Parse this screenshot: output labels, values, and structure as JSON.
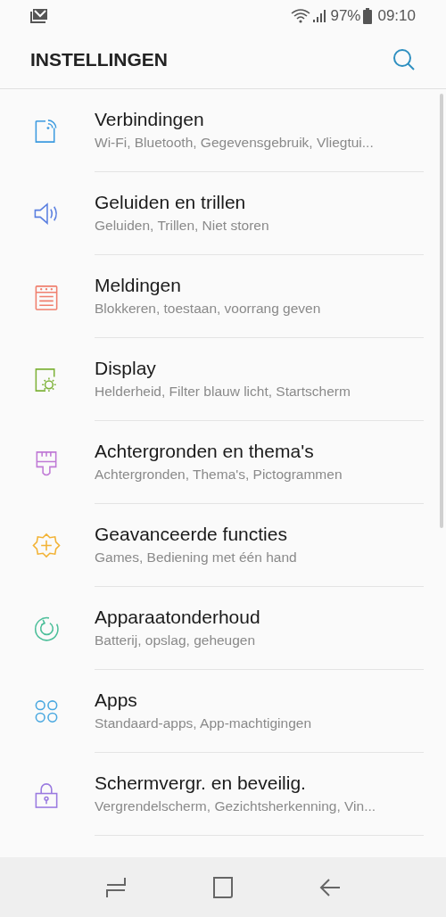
{
  "status_bar": {
    "battery": "97%",
    "time": "09:10"
  },
  "header": {
    "title": "INSTELLINGEN"
  },
  "items": [
    {
      "title": "Verbindingen",
      "subtitle": "Wi-Fi, Bluetooth, Gegevensgebruik, Vliegtui...",
      "color": "#3d9be0"
    },
    {
      "title": "Geluiden en trillen",
      "subtitle": "Geluiden, Trillen, Niet storen",
      "color": "#5a7fe0"
    },
    {
      "title": "Meldingen",
      "subtitle": "Blokkeren, toestaan, voorrang geven",
      "color": "#f07f6e"
    },
    {
      "title": "Display",
      "subtitle": "Helderheid, Filter blauw licht, Startscherm",
      "color": "#7fb33a"
    },
    {
      "title": "Achtergronden en thema's",
      "subtitle": "Achtergronden, Thema's, Pictogrammen",
      "color": "#c07ad6"
    },
    {
      "title": "Geavanceerde functies",
      "subtitle": "Games, Bediening met één hand",
      "color": "#f2b234"
    },
    {
      "title": "Apparaatonderhoud",
      "subtitle": "Batterij, opslag, geheugen",
      "color": "#4dbf9a"
    },
    {
      "title": "Apps",
      "subtitle": "Standaard-apps, App-machtigingen",
      "color": "#4aa8e0"
    },
    {
      "title": "Schermvergr. en beveilig.",
      "subtitle": "Vergrendelscherm, Gezichtsherkenning, Vin...",
      "color": "#9a7ae0"
    }
  ]
}
